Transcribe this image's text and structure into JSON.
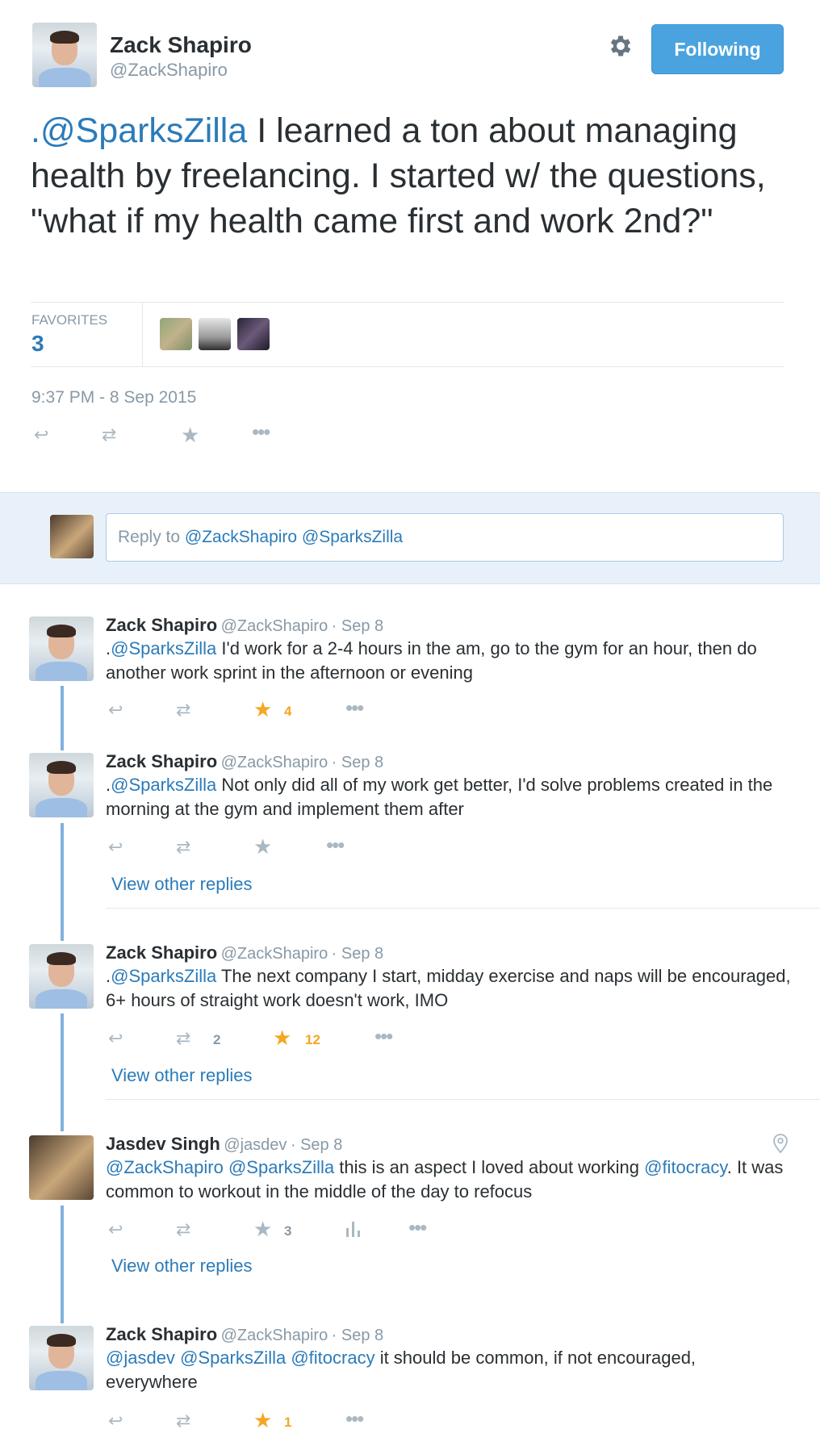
{
  "main_tweet": {
    "author_name": "Zack Shapiro",
    "author_handle": "@ZackShapiro",
    "follow_label": "Following",
    "text_mention": "@SparksZilla",
    "text_prefix": ".",
    "text_body": " I learned a ton about managing health by freelancing. I started w/ the questions, \"what if my health came first and work 2nd?\"",
    "favorites_label": "FAVORITES",
    "favorites_count": "3",
    "timestamp": "9:37 PM - 8 Sep 2015"
  },
  "reply_box": {
    "prefix": "Reply to ",
    "mentions": "@ZackShapiro @SparksZilla"
  },
  "replies": [
    {
      "name": "Zack Shapiro",
      "handle": "@ZackShapiro",
      "date": "· Sep 8",
      "prefix": ".",
      "mention": "@SparksZilla",
      "text": " I'd work for a 2-4 hours in the am, go to the gym for an hour, then do another work sprint in the afternoon or evening",
      "fav_count": "4"
    },
    {
      "name": "Zack Shapiro",
      "handle": "@ZackShapiro",
      "date": "· Sep 8",
      "prefix": ".",
      "mention": "@SparksZilla",
      "text": " Not only did all of my work get better, I'd solve problems created in the morning at the gym and implement them after",
      "view_replies": "View other replies"
    },
    {
      "name": "Zack Shapiro",
      "handle": "@ZackShapiro",
      "date": "· Sep 8",
      "prefix": ".",
      "mention": "@SparksZilla",
      "text": " The next company I start, midday exercise and naps will be encouraged, 6+ hours of straight work doesn't work, IMO",
      "rt_count": "2",
      "fav_count": "12",
      "view_replies": "View other replies"
    },
    {
      "name": "Jasdev Singh",
      "handle": "@jasdev",
      "date": "· Sep 8",
      "mention1": "@ZackShapiro",
      "mention2": "@SparksZilla",
      "text_a": " this is an aspect I loved about working ",
      "mention3": "@fitocracy",
      "text_b": ". It was common to workout in the middle of the day to refocus",
      "fav_count": "3",
      "view_replies": "View other replies"
    },
    {
      "name": "Zack Shapiro",
      "handle": "@ZackShapiro",
      "date": "· Sep 8",
      "mention1": "@jasdev",
      "mention2": "@SparksZilla",
      "mention3": "@fitocracy",
      "text": " it should be common, if not encouraged, everywhere",
      "fav_count": "1"
    }
  ],
  "icons": {
    "reply": "reply-icon",
    "retweet": "retweet-icon",
    "favorite": "star-icon",
    "more": "more-icon",
    "settings": "gear-icon",
    "location": "location-pin-icon",
    "analytics": "analytics-icon"
  },
  "colors": {
    "link": "#2b7bb9",
    "follow_button": "#4aa3df",
    "favorite_active": "#f5a623",
    "reply_bar": "#e8f1f9",
    "thread_line": "#80b1dc"
  }
}
